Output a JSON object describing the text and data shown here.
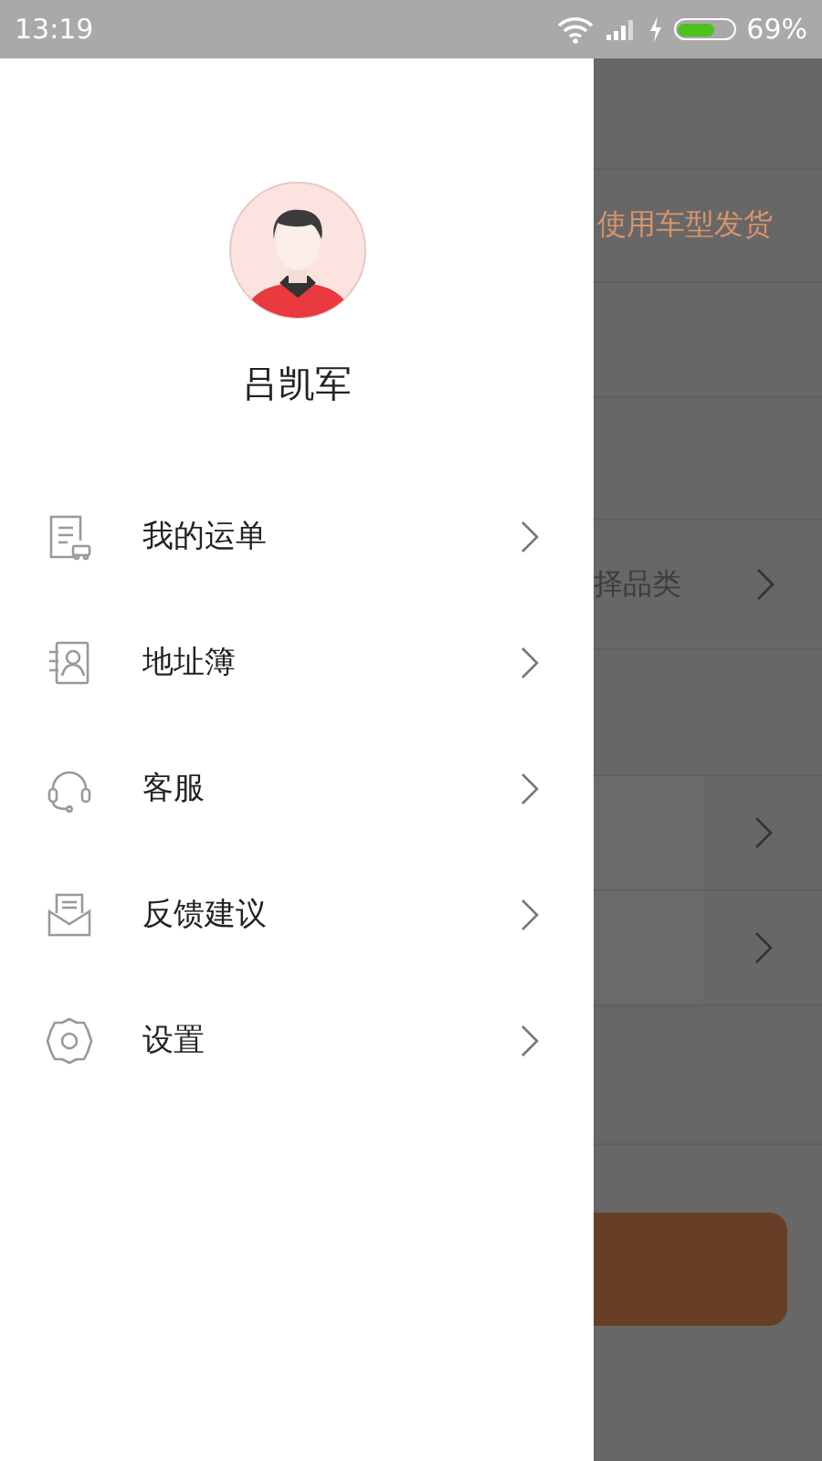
{
  "status_bar": {
    "time": "13:19",
    "battery": "69%"
  },
  "drawer": {
    "user_name": "吕凯军",
    "items": [
      {
        "kind": "orders",
        "label": "我的运单"
      },
      {
        "kind": "address",
        "label": "地址簿"
      },
      {
        "kind": "service",
        "label": "客服"
      },
      {
        "kind": "feedback",
        "label": "反馈建议"
      },
      {
        "kind": "settings",
        "label": "设置"
      }
    ]
  },
  "background": {
    "vehicle_link": "使用车型发货",
    "category": "择品类"
  }
}
